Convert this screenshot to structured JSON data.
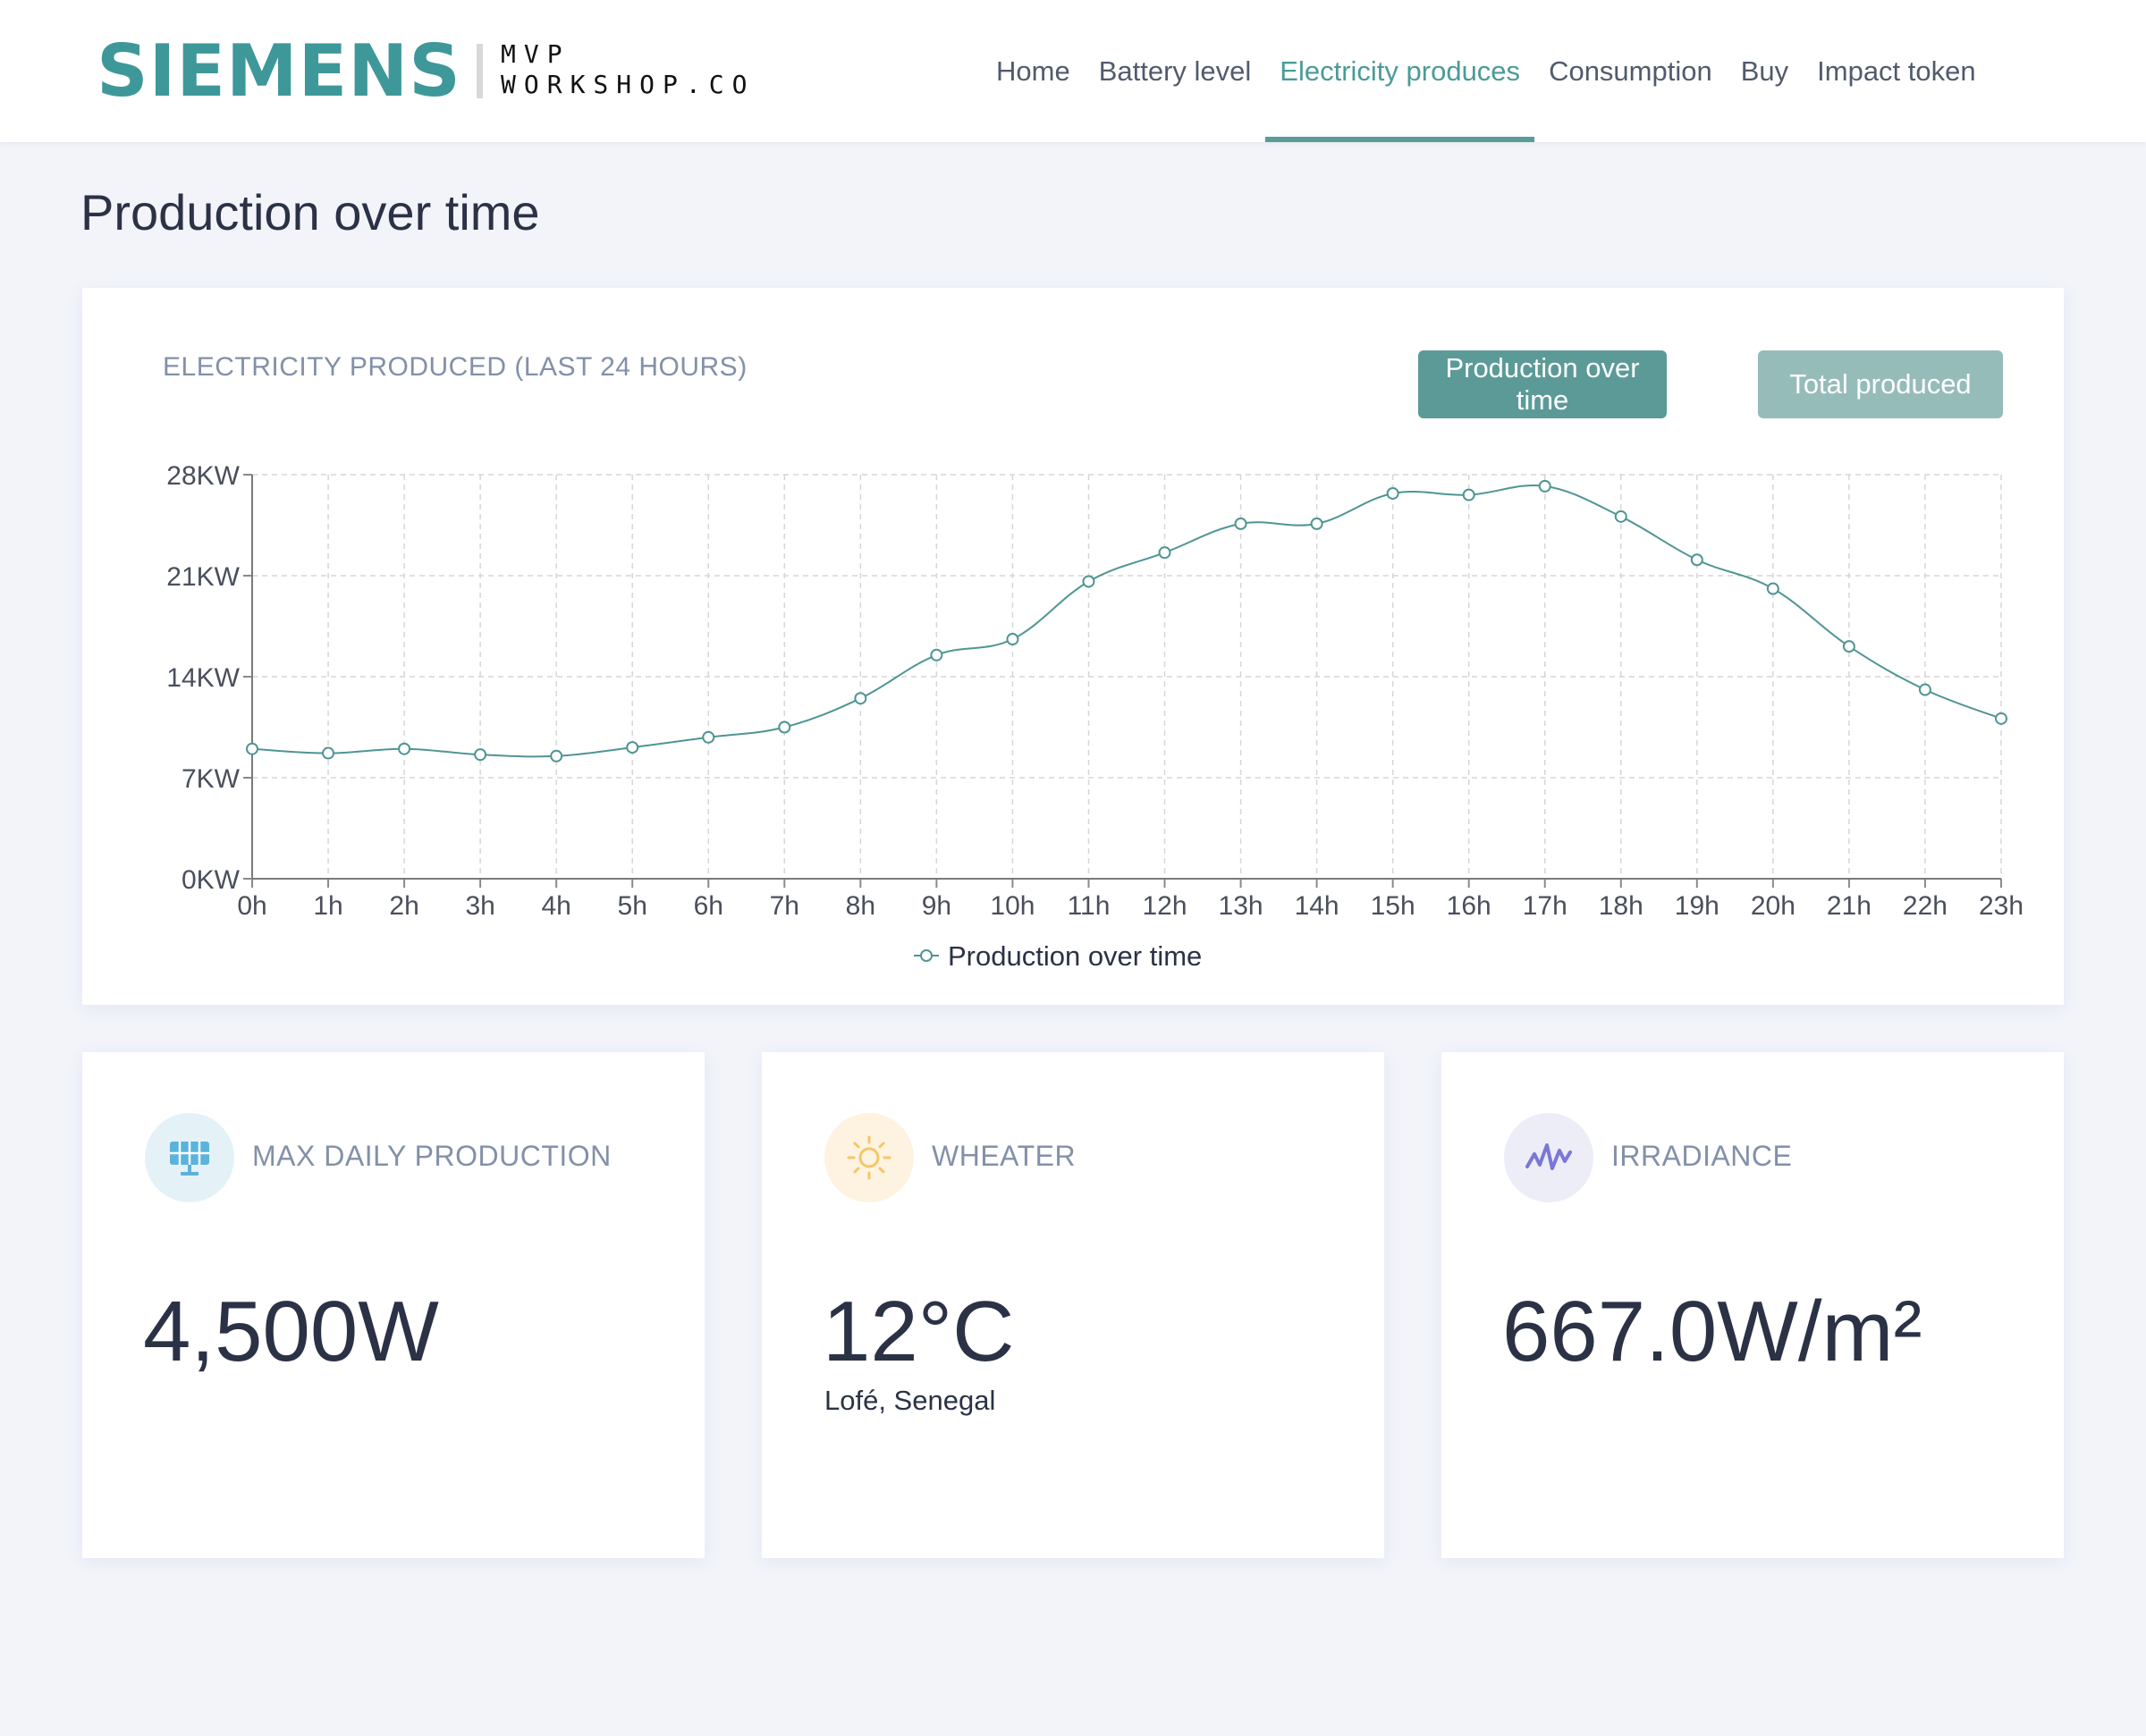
{
  "brand": {
    "logo": "SIEMENS",
    "partner_line1": "MVP",
    "partner_line2": "WORKSHOP.CO"
  },
  "nav": {
    "items": [
      {
        "label": "Home",
        "active": false
      },
      {
        "label": "Battery level",
        "active": false
      },
      {
        "label": "Electricity produces",
        "active": true
      },
      {
        "label": "Consumption",
        "active": false
      },
      {
        "label": "Buy",
        "active": false
      },
      {
        "label": "Impact token",
        "active": false
      }
    ]
  },
  "page": {
    "title": "Production over time"
  },
  "chart_card": {
    "heading": "ELECTRICITY PRODUCED (LAST 24 HOURS)",
    "buttons": {
      "production_over_time": "Production over time",
      "total_produced": "Total produced"
    }
  },
  "chart_data": {
    "type": "line",
    "title": "",
    "xlabel": "",
    "ylabel": "",
    "categories": [
      "0h",
      "1h",
      "2h",
      "3h",
      "4h",
      "5h",
      "6h",
      "7h",
      "8h",
      "9h",
      "10h",
      "11h",
      "12h",
      "13h",
      "14h",
      "15h",
      "16h",
      "17h",
      "18h",
      "19h",
      "20h",
      "21h",
      "22h",
      "23h"
    ],
    "y_ticks": [
      "0KW",
      "7KW",
      "14KW",
      "21KW",
      "28KW"
    ],
    "ylim": [
      0,
      28
    ],
    "grid": true,
    "legend_position": "bottom",
    "series": [
      {
        "name": "Production over time",
        "color": "#4f9593",
        "values": [
          9.0,
          8.7,
          9.0,
          8.6,
          8.5,
          9.1,
          9.8,
          10.5,
          12.5,
          15.5,
          16.6,
          20.6,
          22.6,
          24.6,
          24.6,
          26.7,
          26.6,
          27.2,
          25.1,
          22.1,
          20.1,
          16.1,
          13.1,
          11.1
        ]
      }
    ]
  },
  "stats": [
    {
      "label": "MAX DAILY PRODUCTION",
      "value": "4,500W",
      "sub": "",
      "icon": "solar-panel-icon",
      "icon_bg": "#e4f2f8",
      "icon_color": "#5ab3da"
    },
    {
      "label": "WHEATER",
      "value": "12°C",
      "sub": "Lofé, Senegal",
      "icon": "sun-icon",
      "icon_bg": "#fdf3e0",
      "icon_color": "#f2c766"
    },
    {
      "label": "IRRADIANCE",
      "value": "667.0W/m²",
      "sub": "",
      "icon": "wave-icon",
      "icon_bg": "#ecedf7",
      "icon_color": "#7a77d6"
    }
  ]
}
